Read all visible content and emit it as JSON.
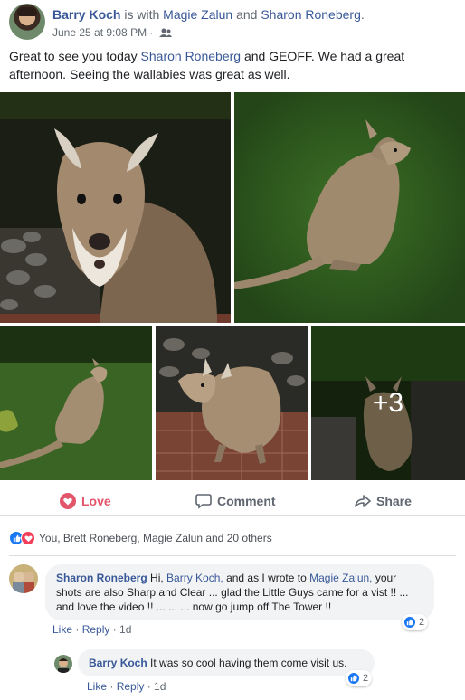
{
  "post": {
    "author": "Barry Koch",
    "with_text": " is with ",
    "tagged_1": "Magie Zalun",
    "and_text": " and ",
    "tagged_2": "Sharon Roneberg",
    "period": ".",
    "timestamp": "June 25 at 9:08 PM",
    "separator": " · ",
    "privacy_icon": "friends-icon",
    "text_before": "Great to see you today ",
    "text_mention": "Sharon Roneberg",
    "text_after": " and GEOFF. We had a great afternoon. Seeing the wallabies was great as well.",
    "more_photos": "+3"
  },
  "actions": {
    "love": "Love",
    "comment": "Comment",
    "share": "Share"
  },
  "reactions": {
    "summary": "You, Brett Roneberg, Magie Zalun and 20 others"
  },
  "comments": [
    {
      "author": "Sharon Roneberg",
      "text_1": " Hi, ",
      "mention_1": "Barry Koch,",
      "text_2": " and as I wrote to ",
      "mention_2": "Magie Zalun,",
      "text_3": " your shots are also Sharp and Clear ... glad the Little Guys came for a vist !! ... and love the video !! ... ... ... now go jump off The Tower !!",
      "like": "Like",
      "dot": " · ",
      "reply": "Reply",
      "age": "1d",
      "reaction_count": "2"
    },
    {
      "author": "Barry Koch",
      "text": " It was so cool having them come visit us.",
      "like": "Like",
      "dot": " · ",
      "reply": "Reply",
      "age": "1d",
      "reaction_count": "2"
    }
  ],
  "colors": {
    "link": "#385898",
    "love": "#e2556a",
    "like_blue": "#1877f2"
  }
}
